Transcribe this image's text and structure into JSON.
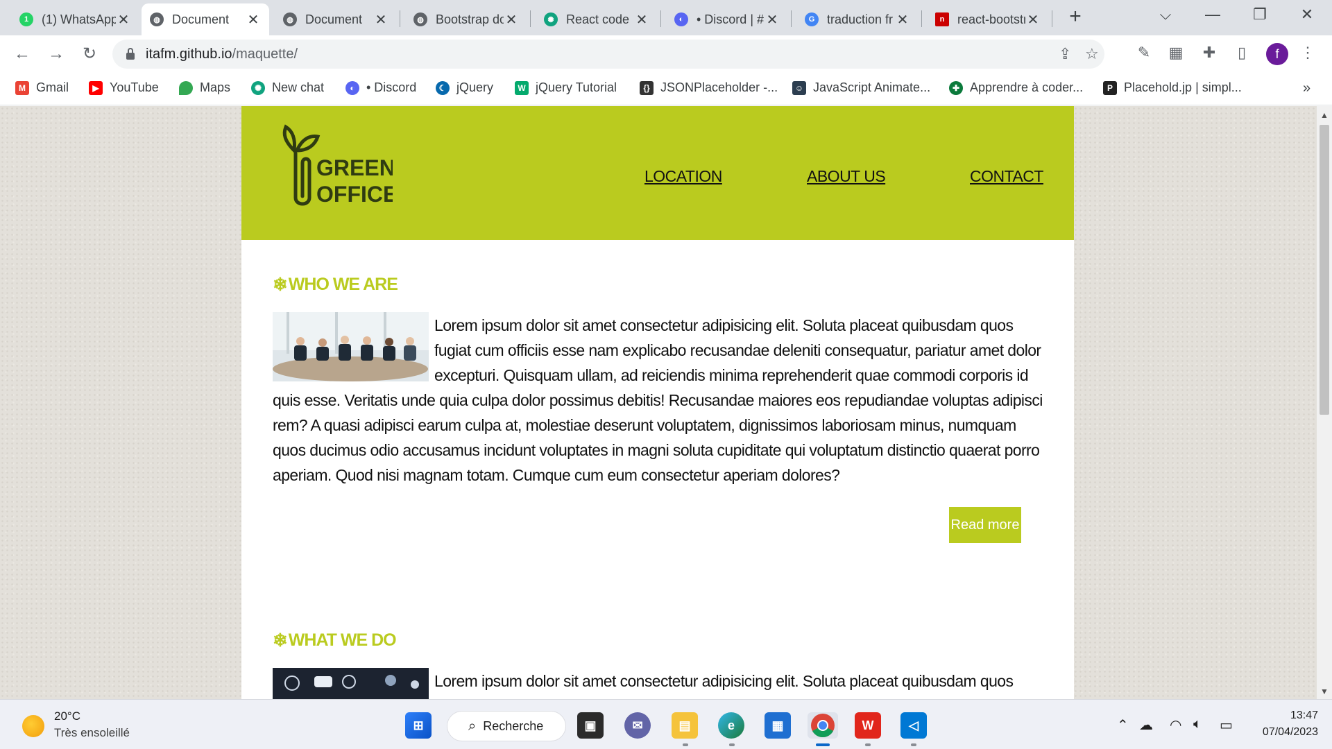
{
  "browser": {
    "tabs": [
      {
        "label": "(1) WhatsApp",
        "icon": "whatsapp-icon",
        "active": false
      },
      {
        "label": "Document",
        "icon": "globe-icon",
        "active": true
      },
      {
        "label": "Document",
        "icon": "globe-icon",
        "active": false
      },
      {
        "label": "Bootstrap doc",
        "icon": "globe-icon",
        "active": false
      },
      {
        "label": "React code",
        "icon": "chatgpt-icon",
        "active": false
      },
      {
        "label": "• Discord | #",
        "icon": "discord-icon",
        "active": false
      },
      {
        "label": "traduction fr",
        "icon": "google-icon",
        "active": false
      },
      {
        "label": "react-bootstrap",
        "icon": "npm-icon",
        "active": false
      }
    ],
    "tab_close": "✕",
    "new_tab": "+",
    "window_controls": {
      "tab_search": "⌵",
      "minimize": "—",
      "restore": "❐",
      "close": "✕"
    },
    "address": {
      "domain": "itafm.github.io",
      "path": "/maquette/"
    },
    "nav": {
      "back": "←",
      "forward": "→",
      "reload": "↻"
    },
    "bookmarks": [
      {
        "label": "Gmail",
        "icon": "gmail-icon",
        "color": "#ea4335"
      },
      {
        "label": "YouTube",
        "icon": "youtube-icon",
        "color": "#ff0000"
      },
      {
        "label": "Maps",
        "icon": "maps-icon",
        "color": "#34a853"
      },
      {
        "label": "New chat",
        "icon": "chatgpt-icon",
        "color": "#10a37f"
      },
      {
        "label": "• Discord",
        "icon": "discord-icon",
        "color": "#5865f2"
      },
      {
        "label": "jQuery",
        "icon": "jquery-icon",
        "color": "#0769ad"
      },
      {
        "label": "jQuery Tutorial",
        "icon": "w3schools-icon",
        "color": "#04aa6d"
      },
      {
        "label": "JSONPlaceholder -...",
        "icon": "jsonplaceholder-icon",
        "color": "#333333"
      },
      {
        "label": "JavaScript Animate...",
        "icon": "avatar-icon",
        "color": "#2c3e50"
      },
      {
        "label": "Apprendre à coder...",
        "icon": "openclassrooms-icon",
        "color": "#0b7a3b"
      },
      {
        "label": "Placehold.jp | simpl...",
        "icon": "placehold-icon",
        "color": "#222222"
      }
    ],
    "bookmarks_more": "»",
    "profile_initial": "f"
  },
  "site": {
    "brand": {
      "line1": "GREEN",
      "line2": "OFFICE"
    },
    "nav": [
      "LOCATION",
      "ABOUT US",
      "CONTACT"
    ],
    "accent": "#bacb1f",
    "sections": [
      {
        "title": "WHO WE ARE",
        "text": "Lorem ipsum dolor sit amet consectetur adipisicing elit. Soluta placeat quibusdam quos fugiat cum officiis esse nam explicabo recusandae deleniti consequatur, pariatur amet dolor excepturi. Quisquam ullam, ad reiciendis minima reprehenderit quae commodi corporis id quis esse. Veritatis unde quia culpa dolor possimus debitis! Recusandae maiores eos repudiandae voluptas adipisci rem? A quasi adipisci earum culpa at, molestiae deserunt voluptatem, dignissimos laboriosam minus, numquam quos ducimus odio accusamus incidunt voluptates in magni soluta cupiditate qui voluptatum distinctio quaerat porro aperiam. Quod nisi magnam totam. Cumque cum eum consectetur aperiam dolores?",
        "button": "Read more"
      },
      {
        "title": "WHAT WE DO",
        "text": "Lorem ipsum dolor sit amet consectetur adipisicing elit. Soluta placeat quibusdam quos fugiat cum"
      }
    ],
    "title_glyph": "❄"
  },
  "taskbar": {
    "weather": {
      "temp": "20°C",
      "desc": "Très ensoleillé"
    },
    "search_label": "Recherche",
    "time": "13:47",
    "date": "07/04/2023"
  }
}
